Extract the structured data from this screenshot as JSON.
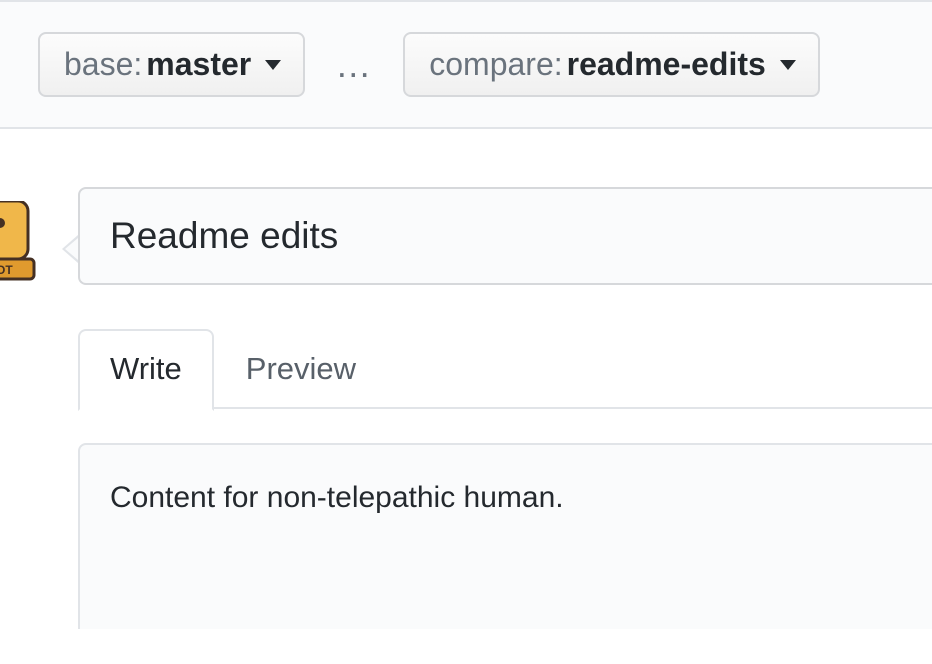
{
  "compare": {
    "base": {
      "label": "base: ",
      "value": "master"
    },
    "ellipsis": "…",
    "head": {
      "label": "compare: ",
      "value": "readme-edits"
    }
  },
  "avatar": {
    "badge_text": "OT"
  },
  "pr": {
    "title": "Readme edits",
    "tabs": {
      "write": "Write",
      "preview": "Preview"
    },
    "body": "Content for non-telepathic human."
  }
}
